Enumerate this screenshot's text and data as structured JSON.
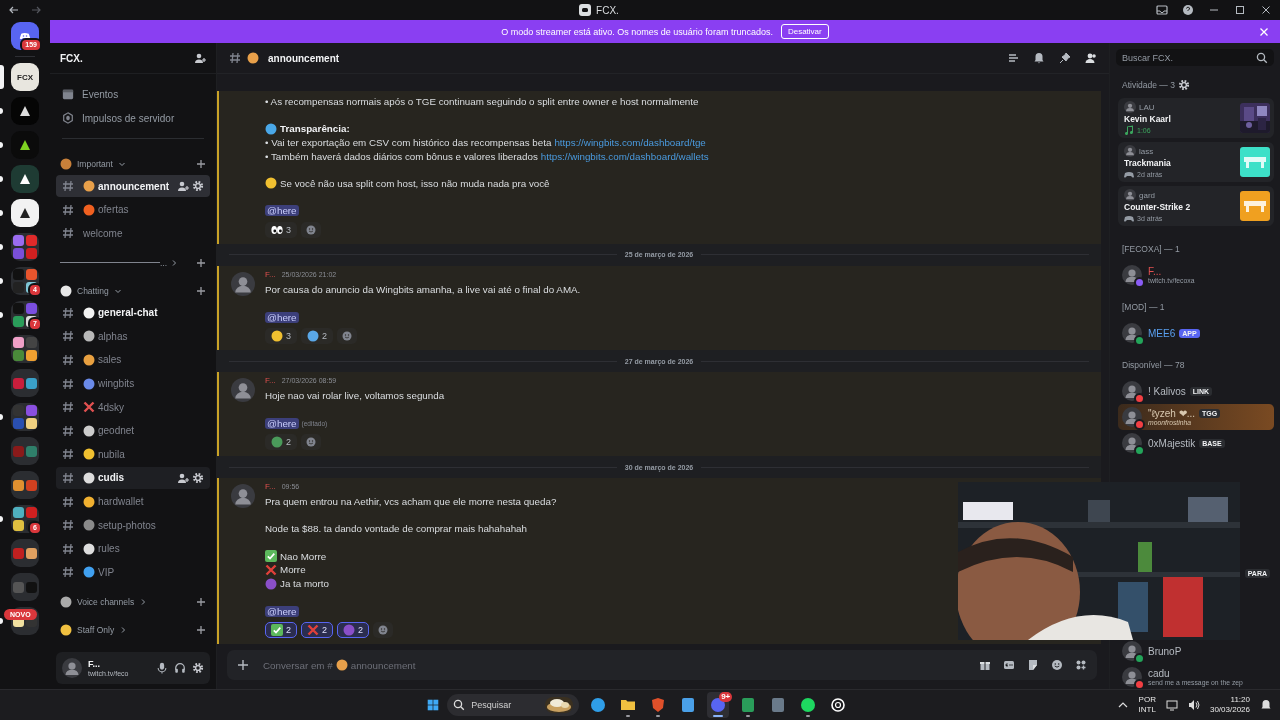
{
  "window": {
    "title": "FCX."
  },
  "banner": {
    "text": "O modo streamer está ativo. Os nomes de usuário foram truncados.",
    "button": "Desativar"
  },
  "servers": [
    {
      "kind": "discord",
      "color": "#5865f2",
      "badge": "159",
      "unread": false,
      "selected": false
    },
    {
      "kind": "tile",
      "color": "#e8e6df",
      "logo_text": "FCX",
      "unread": false,
      "selected": true
    },
    {
      "kind": "tile",
      "color": "#050505",
      "logo": {
        "color": "#dddddd"
      },
      "unread": true,
      "selected": false
    },
    {
      "kind": "tile",
      "color": "#0b0b0b",
      "logo": {
        "color": "#7ed321"
      },
      "unread": true,
      "selected": false
    },
    {
      "kind": "tile",
      "color": "#1e3b33",
      "logo": {
        "color": "#ffffff"
      },
      "unread": true,
      "selected": false
    },
    {
      "kind": "tile",
      "color": "#f2f2f2",
      "logo": {
        "color": "#222222"
      },
      "unread": true,
      "selected": false
    },
    {
      "kind": "folder",
      "tiles": [
        {
          "color": "#9b6cf0"
        },
        {
          "color": "#e02a2a"
        },
        {
          "color": "#7a4fd8"
        },
        {
          "color": "#d02020"
        }
      ],
      "unread": true,
      "selected": false
    },
    {
      "kind": "folder",
      "tiles": [
        {
          "color": "#111111"
        },
        {
          "color": "#e8552d"
        },
        {
          "color": "#222222"
        },
        {
          "color": "#7fc6d6"
        }
      ],
      "badge": "4",
      "unread": true,
      "selected": false
    },
    {
      "kind": "folder",
      "tiles": [
        {
          "color": "#111111"
        },
        {
          "color": "#7b4fe0"
        },
        {
          "color": "#2a9d5a"
        },
        {
          "color": "#dddddd"
        }
      ],
      "badge": "7",
      "unread": true,
      "selected": false
    },
    {
      "kind": "folder",
      "tiles": [
        {
          "color": "#f0a0c8"
        },
        {
          "color": "#444444"
        },
        {
          "color": "#4a8a3a"
        },
        {
          "color": "#f0a030"
        }
      ],
      "unread": false,
      "selected": false
    },
    {
      "kind": "folder",
      "tiles": [
        {
          "color": "#c81e3c"
        },
        {
          "color": "#3aa0c8"
        }
      ],
      "unread": false,
      "selected": false
    },
    {
      "kind": "folder",
      "tiles": [
        {
          "color": "#333333"
        },
        {
          "color": "#8a4fe0"
        },
        {
          "color": "#2a4fb0"
        },
        {
          "color": "#f0d080"
        }
      ],
      "unread": true,
      "selected": false
    },
    {
      "kind": "folder",
      "tiles": [
        {
          "color": "#8a1a1a"
        },
        {
          "color": "#2f7f6a"
        }
      ],
      "unread": false,
      "selected": false
    },
    {
      "kind": "folder",
      "tiles": [
        {
          "color": "#e09030"
        },
        {
          "color": "#d04020"
        }
      ],
      "unread": false,
      "selected": false
    },
    {
      "kind": "folder",
      "tiles": [
        {
          "color": "#4fb0c0"
        },
        {
          "color": "#d02020"
        },
        {
          "color": "#e0c040"
        },
        {
          "color": "#222222"
        }
      ],
      "badge": "6",
      "unread": true,
      "selected": false
    },
    {
      "kind": "folder",
      "tiles": [
        {
          "color": "#c02020"
        },
        {
          "color": "#e0a060"
        }
      ],
      "unread": false,
      "selected": false
    },
    {
      "kind": "folder",
      "tiles": [
        {
          "color": "#555555"
        },
        {
          "color": "#111111"
        }
      ],
      "unread": false,
      "selected": false
    },
    {
      "kind": "folder",
      "tiles": [
        {
          "color": "#f0e0a0"
        },
        {
          "color": "#333333"
        }
      ],
      "label": "NOVO",
      "unread": true,
      "selected": false
    }
  ],
  "sidebar": {
    "server_name": "FCX.",
    "shortcuts": [
      {
        "label": "Eventos",
        "kind": "events"
      },
      {
        "label": "Impulsos de servidor",
        "kind": "boost"
      }
    ],
    "categories": [
      {
        "kind": "category",
        "name": "Important",
        "emoji": {
          "kind": "blob",
          "color": "#c8803a"
        },
        "expanded": true,
        "channels": [
          {
            "name": "announcement",
            "emoji": {
              "kind": "blob",
              "color": "#e8a04a"
            },
            "selected": true,
            "hovered": false,
            "unread": true
          },
          {
            "name": "ofertas",
            "emoji": {
              "kind": "blob",
              "color": "#f06020"
            },
            "selected": false,
            "hovered": false,
            "unread": false
          },
          {
            "name": "welcome",
            "selected": false,
            "hovered": false,
            "unread": false
          }
        ]
      },
      {
        "kind": "line",
        "name": "...",
        "expanded": false
      },
      {
        "kind": "category",
        "name": "Chatting",
        "emoji": {
          "kind": "blob",
          "color": "#e8e8e8"
        },
        "expanded": true,
        "channels": [
          {
            "name": "general-chat",
            "emoji": {
              "kind": "blob",
              "color": "#f2f2f2"
            },
            "selected": false,
            "hovered": false,
            "unread": true
          },
          {
            "name": "alphas",
            "emoji": {
              "kind": "blob",
              "color": "#b8b8b8"
            },
            "selected": false,
            "hovered": false,
            "unread": false
          },
          {
            "name": "sales",
            "emoji": {
              "kind": "blob",
              "color": "#e8a040"
            },
            "selected": false,
            "hovered": false,
            "unread": false
          },
          {
            "name": "wingbits",
            "emoji": {
              "kind": "blob",
              "color": "#6a8ae8"
            },
            "selected": false,
            "hovered": false,
            "unread": false
          },
          {
            "name": "4dsky",
            "emoji": {
              "kind": "cross",
              "color": "#e05050"
            },
            "selected": false,
            "hovered": false,
            "unread": false
          },
          {
            "name": "geodnet",
            "emoji": {
              "kind": "blob",
              "color": "#cccccc"
            },
            "selected": false,
            "hovered": false,
            "unread": false
          },
          {
            "name": "nubila",
            "emoji": {
              "kind": "blob",
              "color": "#f0c030"
            },
            "selected": false,
            "hovered": false,
            "unread": false
          },
          {
            "name": "cudis",
            "emoji": {
              "kind": "blob",
              "color": "#dddddd"
            },
            "selected": false,
            "hovered": true,
            "unread": true
          },
          {
            "name": "hardwallet",
            "emoji": {
              "kind": "blob",
              "color": "#f0b030"
            },
            "selected": false,
            "hovered": false,
            "unread": false
          },
          {
            "name": "setup-photos",
            "emoji": {
              "kind": "blob",
              "color": "#8a8a8a"
            },
            "selected": false,
            "hovered": false,
            "unread": false
          },
          {
            "name": "rules",
            "emoji": {
              "kind": "blob",
              "color": "#dddddd"
            },
            "selected": false,
            "hovered": false,
            "unread": false
          },
          {
            "name": "VIP",
            "emoji": {
              "kind": "blob",
              "color": "#40a0f0"
            },
            "selected": false,
            "hovered": false,
            "unread": false
          }
        ]
      },
      {
        "kind": "category",
        "name": "Voice channels",
        "emoji": {
          "kind": "blob",
          "color": "#aaaaaa"
        },
        "expanded": false
      },
      {
        "kind": "category",
        "name": "Staff Only",
        "emoji": {
          "kind": "blob",
          "color": "#f0c040"
        },
        "expanded": false
      }
    ],
    "user": {
      "name": "F...",
      "status": "twitch.tv/feco"
    }
  },
  "channel": {
    "name": "announcement",
    "emoji": {
      "kind": "blob",
      "color": "#e8a04a"
    }
  },
  "messages": [
    {
      "kind": "message",
      "highlighted": true,
      "lines": [
        {
          "kind": "text",
          "text": "• As recompensas normais após o TGE continuam seguindo o split entre owner e host normalmente"
        },
        {
          "kind": "blank"
        },
        {
          "kind": "heading",
          "text": "Transparência:",
          "emoji": {
            "kind": "blob",
            "color": "#4aa8e8"
          }
        },
        {
          "kind": "text",
          "text": "• Vai ter exportação em CSV com histórico das recompensas beta",
          "link": "https://wingbits.com/dashboard/tge"
        },
        {
          "kind": "text",
          "text": "• Também haverá dados diários com bônus e valores liberados",
          "link": "https://wingbits.com/dashboard/wallets"
        },
        {
          "kind": "blank"
        },
        {
          "kind": "text",
          "text": "Se você não usa split com host, isso não muda nada pra você",
          "emoji": {
            "kind": "blob",
            "color": "#f0c030"
          }
        },
        {
          "kind": "blank"
        }
      ],
      "mention": "@here",
      "reactions": [
        {
          "emoji": {
            "kind": "eyes",
            "color": "#ffffff"
          },
          "count": "3",
          "selected": false
        }
      ]
    },
    {
      "kind": "divider",
      "text": "25 de março de 2026"
    },
    {
      "kind": "message",
      "highlighted": true,
      "author": "F...",
      "time": "25/03/2026 21:02",
      "lines": [
        {
          "kind": "text",
          "text": "Por causa do anuncio da Wingbits amanha, a live vai até o final do AMA."
        },
        {
          "kind": "blank"
        }
      ],
      "mention": "@here",
      "reactions": [
        {
          "emoji": {
            "kind": "blob",
            "color": "#f0c030"
          },
          "count": "3",
          "selected": false
        },
        {
          "emoji": {
            "kind": "blob",
            "color": "#5aa8e8"
          },
          "count": "2",
          "selected": false
        }
      ]
    },
    {
      "kind": "divider",
      "text": "27 de março de 2026"
    },
    {
      "kind": "message",
      "highlighted": true,
      "author": "F...",
      "time": "27/03/2026 08:59",
      "lines": [
        {
          "kind": "text",
          "text": "Hoje nao vai rolar live, voltamos segunda"
        },
        {
          "kind": "blank"
        }
      ],
      "mention": "@here",
      "edited": "(editado)",
      "reactions": [
        {
          "emoji": {
            "kind": "blob",
            "color": "#4a9a5a"
          },
          "count": "2",
          "selected": false
        }
      ]
    },
    {
      "kind": "divider",
      "text": "30 de março de 2026"
    },
    {
      "kind": "message",
      "highlighted": true,
      "author": "F...",
      "time": "09:56",
      "lines": [
        {
          "kind": "text",
          "text": "Pra quem entrou na Aethir, vcs acham que ele morre nesta queda?"
        },
        {
          "kind": "blank"
        },
        {
          "kind": "text",
          "text": "Node ta $88. ta dando vontade de comprar mais hahahahah"
        },
        {
          "kind": "blank"
        },
        {
          "kind": "text",
          "text": "Nao Morre",
          "emoji": {
            "kind": "check",
            "color": "#5cb85c"
          }
        },
        {
          "kind": "text",
          "text": "Morre",
          "emoji": {
            "kind": "cross",
            "color": "#e0403a"
          }
        },
        {
          "kind": "text",
          "text": "Ja ta morto",
          "emoji": {
            "kind": "blob",
            "color": "#8a4fc8"
          }
        },
        {
          "kind": "blank"
        }
      ],
      "mention": "@here",
      "reactions": [
        {
          "emoji": {
            "kind": "check",
            "color": "#5cb85c"
          },
          "count": "2",
          "selected": true
        },
        {
          "emoji": {
            "kind": "cross",
            "color": "#e0403a"
          },
          "count": "2",
          "selected": true
        },
        {
          "emoji": {
            "kind": "blob",
            "color": "#8a4fc8"
          },
          "count": "2",
          "selected": true
        }
      ]
    }
  ],
  "composer": {
    "placeholder": "Conversar em #",
    "channel": "announcement",
    "emoji": {
      "kind": "blob",
      "color": "#e8a04a"
    }
  },
  "members": {
    "search": {
      "placeholder": "Buscar FCX."
    },
    "activity": {
      "title": "Atividade — 3",
      "cards": [
        {
          "kind": "music",
          "user": "LAU",
          "title": "Kevin Kaarl",
          "detail": "1:06"
        },
        {
          "kind": "game",
          "user": "lass",
          "title": "Trackmania",
          "detail": "2d atrás",
          "color": "#3de0c8"
        },
        {
          "kind": "game",
          "user": "gard",
          "title": "Counter-Strike 2",
          "detail": "3d atrás",
          "color": "#f0a020"
        }
      ]
    },
    "groups": [
      {
        "title": "[FECOXA] — 1",
        "members": [
          {
            "kind": "plain",
            "name": "F...",
            "status": "twitch.tv/fecoxa",
            "color": "#e05050",
            "status_dot": {
              "color": "#8a5cf5"
            }
          }
        ]
      },
      {
        "title": "[MOD] — 1",
        "members": [
          {
            "kind": "plain",
            "name": "MEE6",
            "color": "#5aa0f0",
            "status_dot": {
              "color": "#23a55a"
            },
            "tag": {
              "kind": "bot",
              "text": "APP"
            }
          }
        ]
      },
      {
        "title": "Disponível — 78",
        "members": [
          {
            "kind": "plain",
            "name": "! Kalivos",
            "status_dot": {
              "color": "#f23f43"
            },
            "tag": {
              "kind": "guild",
              "text": "LINK"
            }
          },
          {
            "kind": "nameplate",
            "name": "\"ℓyzeh ❤...",
            "status": "moonfrostinha",
            "color": "#d8c8b0",
            "status_dot": {
              "color": "#f23f43"
            },
            "tag": {
              "kind": "guild",
              "text": "TGG"
            }
          },
          {
            "kind": "plain",
            "name": "0xMajestik",
            "status_dot": {
              "color": "#23a55a"
            },
            "tag": {
              "kind": "guild",
              "text": "BASE"
            }
          },
          {
            "kind": "covered"
          },
          {
            "kind": "covered"
          },
          {
            "kind": "covered"
          },
          {
            "kind": "covered"
          },
          {
            "kind": "covered",
            "tag": {
              "kind": "guild",
              "text": "PARA"
            }
          },
          {
            "kind": "covered"
          },
          {
            "kind": "covered"
          },
          {
            "kind": "plain",
            "name": "BrunoP",
            "status_dot": {
              "color": "#23a55a"
            }
          },
          {
            "kind": "plain",
            "name": "cadu",
            "status": "send me a message on the zep",
            "status_dot": {
              "color": "#f23f43"
            }
          }
        ]
      }
    ]
  },
  "taskbar": {
    "search": "Pesquisar",
    "apps": [
      {
        "kind": "circle",
        "color": "#2f9ee8",
        "running": false,
        "active": false
      },
      {
        "kind": "folder",
        "color": "#f0c040",
        "running": true,
        "active": false
      },
      {
        "kind": "shield",
        "color": "#e0502a",
        "running": true,
        "active": false
      },
      {
        "kind": "square",
        "color": "#4aa0e8",
        "running": false,
        "active": false
      },
      {
        "kind": "circle",
        "color": "#5865f2",
        "badge": "9+",
        "running": true,
        "active": true
      },
      {
        "kind": "square",
        "color": "#2a9d5a",
        "running": true,
        "active": false
      },
      {
        "kind": "square",
        "color": "#6a7a8a",
        "running": false,
        "active": false
      },
      {
        "kind": "circle",
        "color": "#1ed760",
        "running": true,
        "active": false
      },
      {
        "kind": "ring",
        "color": "#ffffff",
        "running": false,
        "active": false
      }
    ],
    "language": [
      "POR",
      "INTL"
    ],
    "time": "11:20",
    "date": "30/03/2026"
  }
}
